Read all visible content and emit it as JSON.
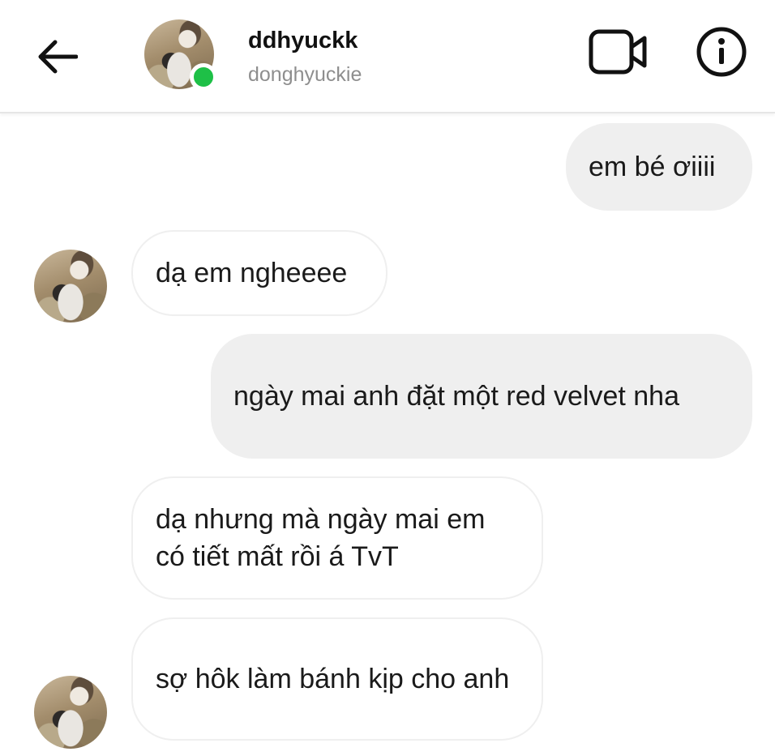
{
  "header": {
    "display_name": "ddhyuckk",
    "username": "donghyuckie",
    "online": true
  },
  "icons": {
    "back": "back-arrow-icon",
    "video": "video-camera-icon",
    "info": "info-icon"
  },
  "colors": {
    "online_dot": "#1ec047",
    "sent_bubble": "#efefef",
    "received_border": "#efefef",
    "username": "#8e8e8e"
  },
  "messages": [
    {
      "direction": "sent",
      "text": "em bé ơiiii"
    },
    {
      "direction": "received",
      "text": "dạ em ngheeee"
    },
    {
      "direction": "sent",
      "text": "ngày mai anh đặt một red velvet nha"
    },
    {
      "direction": "received",
      "text": "dạ nhưng mà ngày mai em có tiết mất rồi á TvT"
    },
    {
      "direction": "received",
      "text": "sợ hôk làm bánh kịp cho anh"
    }
  ]
}
